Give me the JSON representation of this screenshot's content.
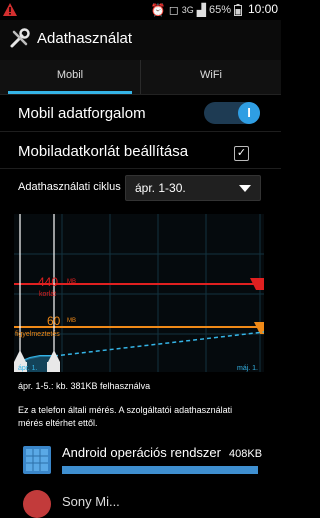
{
  "status_bar": {
    "warning_icon": "warning-icon",
    "network_type": "3G",
    "battery_percent": "65%",
    "time": "10:00"
  },
  "header": {
    "title": "Adathasználat",
    "icon": "wrench-icon"
  },
  "tabs": [
    {
      "label": "Mobil",
      "active": true
    },
    {
      "label": "WiFi",
      "active": false
    }
  ],
  "settings": {
    "mobile_data_label": "Mobil adatforgalom",
    "mobile_data_on": true,
    "mobile_data_limit_label": "Mobiladatkorlát beállítása",
    "mobile_data_limit_checked": true,
    "cycle_label": "Adathasználati ciklus",
    "cycle_value": "ápr. 1-30."
  },
  "chart_data": {
    "type": "line",
    "limit": {
      "value": "440",
      "unit": "MB",
      "label": "korlát"
    },
    "warning": {
      "value": "60",
      "unit": "MB",
      "label": "figyelmeztetés"
    },
    "x_start_label": "ápr. 1.",
    "x_end_label": "máj. 1.",
    "colors": {
      "limit": "#e02020",
      "warning": "#f08a18",
      "usage": "#35b4e6"
    }
  },
  "usage_summary": "ápr. 1-5.: kb. 381KB felhasználva",
  "note": "Ez a telefon általi mérés. A szolgáltatói adathasználati mérés eltérhet ettől.",
  "apps": [
    {
      "name": "Android operációs rendszer",
      "size": "408KB"
    },
    {
      "name": "Sony Mi..."
    }
  ],
  "accent_color": "#35b4e6"
}
